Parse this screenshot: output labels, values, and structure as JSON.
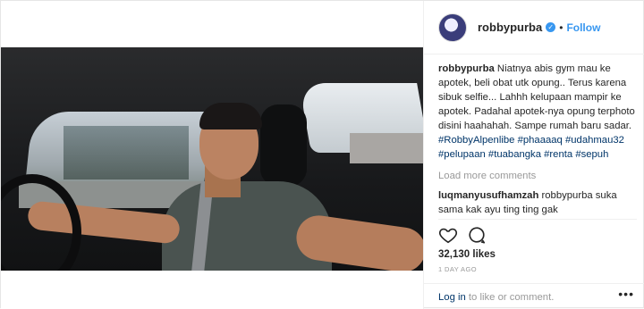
{
  "post": {
    "username": "robbypurba",
    "verified_icon": "verified-badge-icon",
    "separator": "•",
    "follow_label": "Follow",
    "photo_alt": "man smiling while driving a car"
  },
  "caption": {
    "user": "robbypurba",
    "text": " Niatnya abis gym mau ke apotek, beli obat utk opung.. Terus karena sibuk selfie... Lahhh kelupaan mampir ke apotek. Padahal apotek-nya opung terphoto disini haahahah. Sampe rumah baru sadar. ",
    "tags": [
      "#RobbyAlpenlibe",
      "#phaaaaq",
      "#udahmau32",
      "#pelupaan",
      "#tuabangka",
      "#renta",
      "#sepuh"
    ]
  },
  "load_more": "Load more comments",
  "comment": {
    "user": "luqmanyusufhamzah",
    "text": " robbypurba suka sama kak ayu ting ting gak"
  },
  "actions": {
    "like_icon": "heart-icon",
    "comment_icon": "comment-bubble-icon"
  },
  "likes": "32,130 likes",
  "time_ago": "1 DAY AGO",
  "footer": {
    "login_link": "Log in",
    "login_text": " to like or comment.",
    "more_icon": "ellipsis-icon",
    "more_label": "•••"
  }
}
